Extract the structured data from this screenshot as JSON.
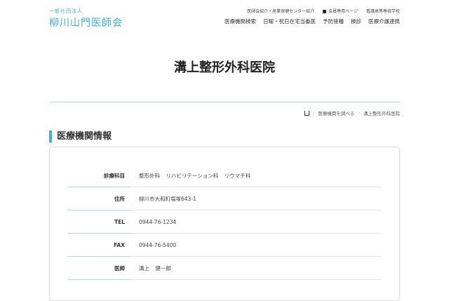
{
  "header": {
    "logo_sub": "一般社団法人",
    "logo_main": "柳川山門医師会",
    "util": [
      "医師会紹介・産業保健センター紹介",
      "会員専用ページ",
      "看護高等専修学校"
    ],
    "nav": [
      "医療機関検索",
      "日曜・祝日在宅当番医",
      "予防接種",
      "検診",
      "医療介護連携"
    ]
  },
  "page_title": "溝上整形外科医院",
  "breadcrumb": [
    "医療機関を調べる",
    "溝上整形外科医院"
  ],
  "section_title": "医療機関情報",
  "rows": [
    {
      "label": "診療科目",
      "value": "整形外科 リハビリテーション科 リウマチ科"
    },
    {
      "label": "住所",
      "value": "柳川市大和町塩塚643-1"
    },
    {
      "label": "TEL",
      "value": "0944-76-1234"
    },
    {
      "label": "FAX",
      "value": "0944-76-5400"
    },
    {
      "label": "医師",
      "value": "溝上 健一郎"
    }
  ]
}
